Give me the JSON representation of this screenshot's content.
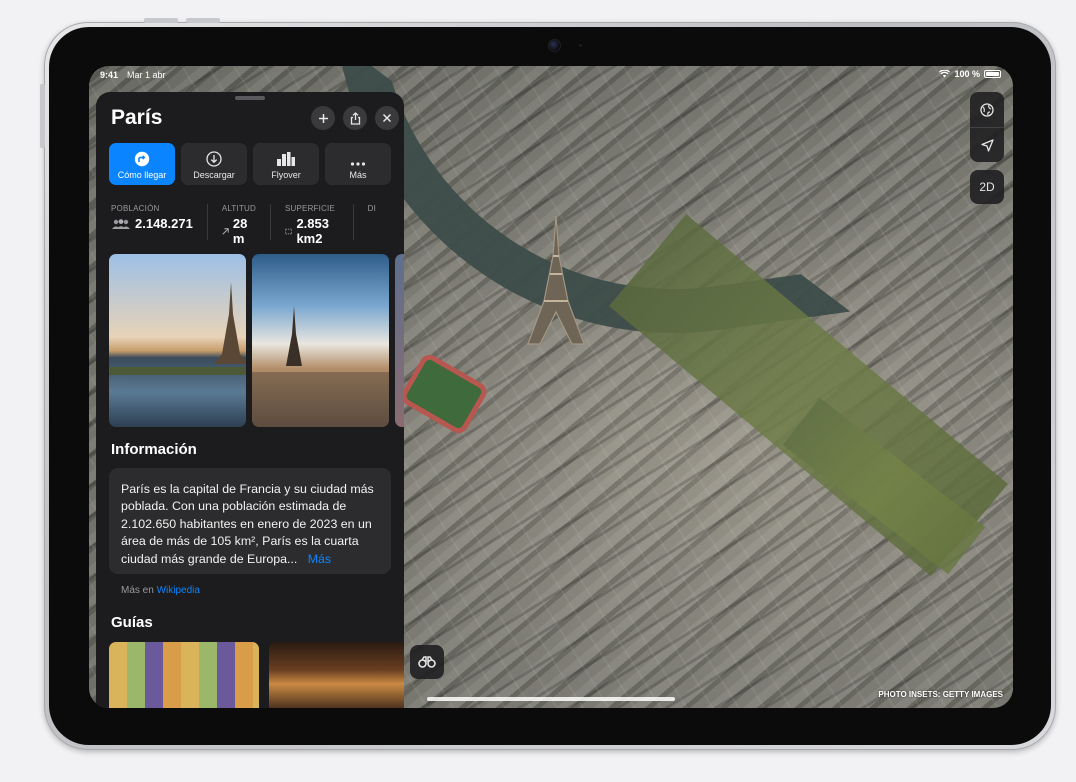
{
  "status_bar": {
    "time": "9:41",
    "date": "Mar 1 abr",
    "battery": "100 %"
  },
  "place": {
    "title": "París"
  },
  "actions": [
    {
      "label": "Cómo llegar",
      "icon": "directions-icon"
    },
    {
      "label": "Descargar",
      "icon": "download-icon"
    },
    {
      "label": "Flyover",
      "icon": "flyover-icon"
    },
    {
      "label": "Más",
      "icon": "more-icon"
    }
  ],
  "facts": [
    {
      "key": "POBLACIÓN",
      "value": "2.148.271",
      "icon": "people-icon"
    },
    {
      "key": "ALTITUD",
      "value": "28 m",
      "icon": "elevation-arrow-icon"
    },
    {
      "key": "SUPERFICIE",
      "value": "2.853 km2",
      "icon": "area-icon"
    },
    {
      "key": "DI",
      "value": "",
      "icon": ""
    }
  ],
  "info": {
    "heading": "Información",
    "text": "París es la capital de Francia y su ciudad más poblada. Con una población estimada de 2.102.650 habitantes en enero de 2023 en un área de más de 105 km², París es la cuarta ciudad más grande de Europa...",
    "more_label": "Más",
    "source_prefix": "Más en",
    "source_link": "Wikipedia"
  },
  "guides": {
    "heading": "Guías"
  },
  "map": {
    "mode_label": "2D",
    "credit": "PHOTO INSETS: GETTY IMAGES"
  },
  "colors": {
    "accent": "#0a84ff",
    "sheet_bg": "#1c1c1e",
    "card_bg": "#2c2c2e"
  }
}
